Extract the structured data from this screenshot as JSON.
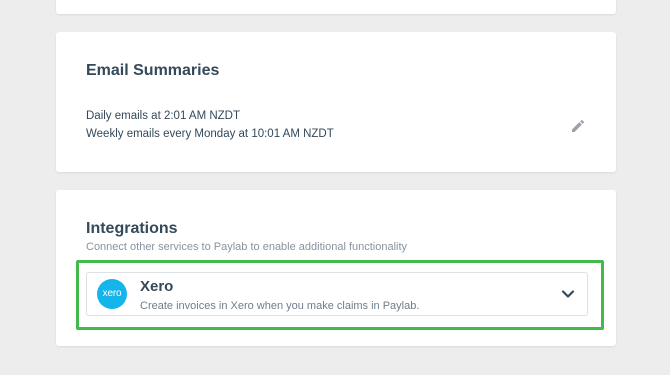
{
  "email_summaries": {
    "title": "Email Summaries",
    "daily": "Daily emails at 2:01 AM NZDT",
    "weekly": "Weekly emails every Monday at 10:01 AM NZDT",
    "edit_icon": "pencil-icon"
  },
  "integrations": {
    "title": "Integrations",
    "subtitle": "Connect other services to Paylab to enable additional functionality",
    "items": [
      {
        "logo_text": "xero",
        "name": "Xero",
        "description": "Create invoices in Xero when you make claims in Paylab.",
        "expand_icon": "chevron-down-icon"
      }
    ]
  },
  "colors": {
    "background": "#ededed",
    "card": "#ffffff",
    "highlight": "#44b94c",
    "xero_brand": "#13b5ea",
    "title_text": "#34495a",
    "muted_text": "#8793a0"
  }
}
